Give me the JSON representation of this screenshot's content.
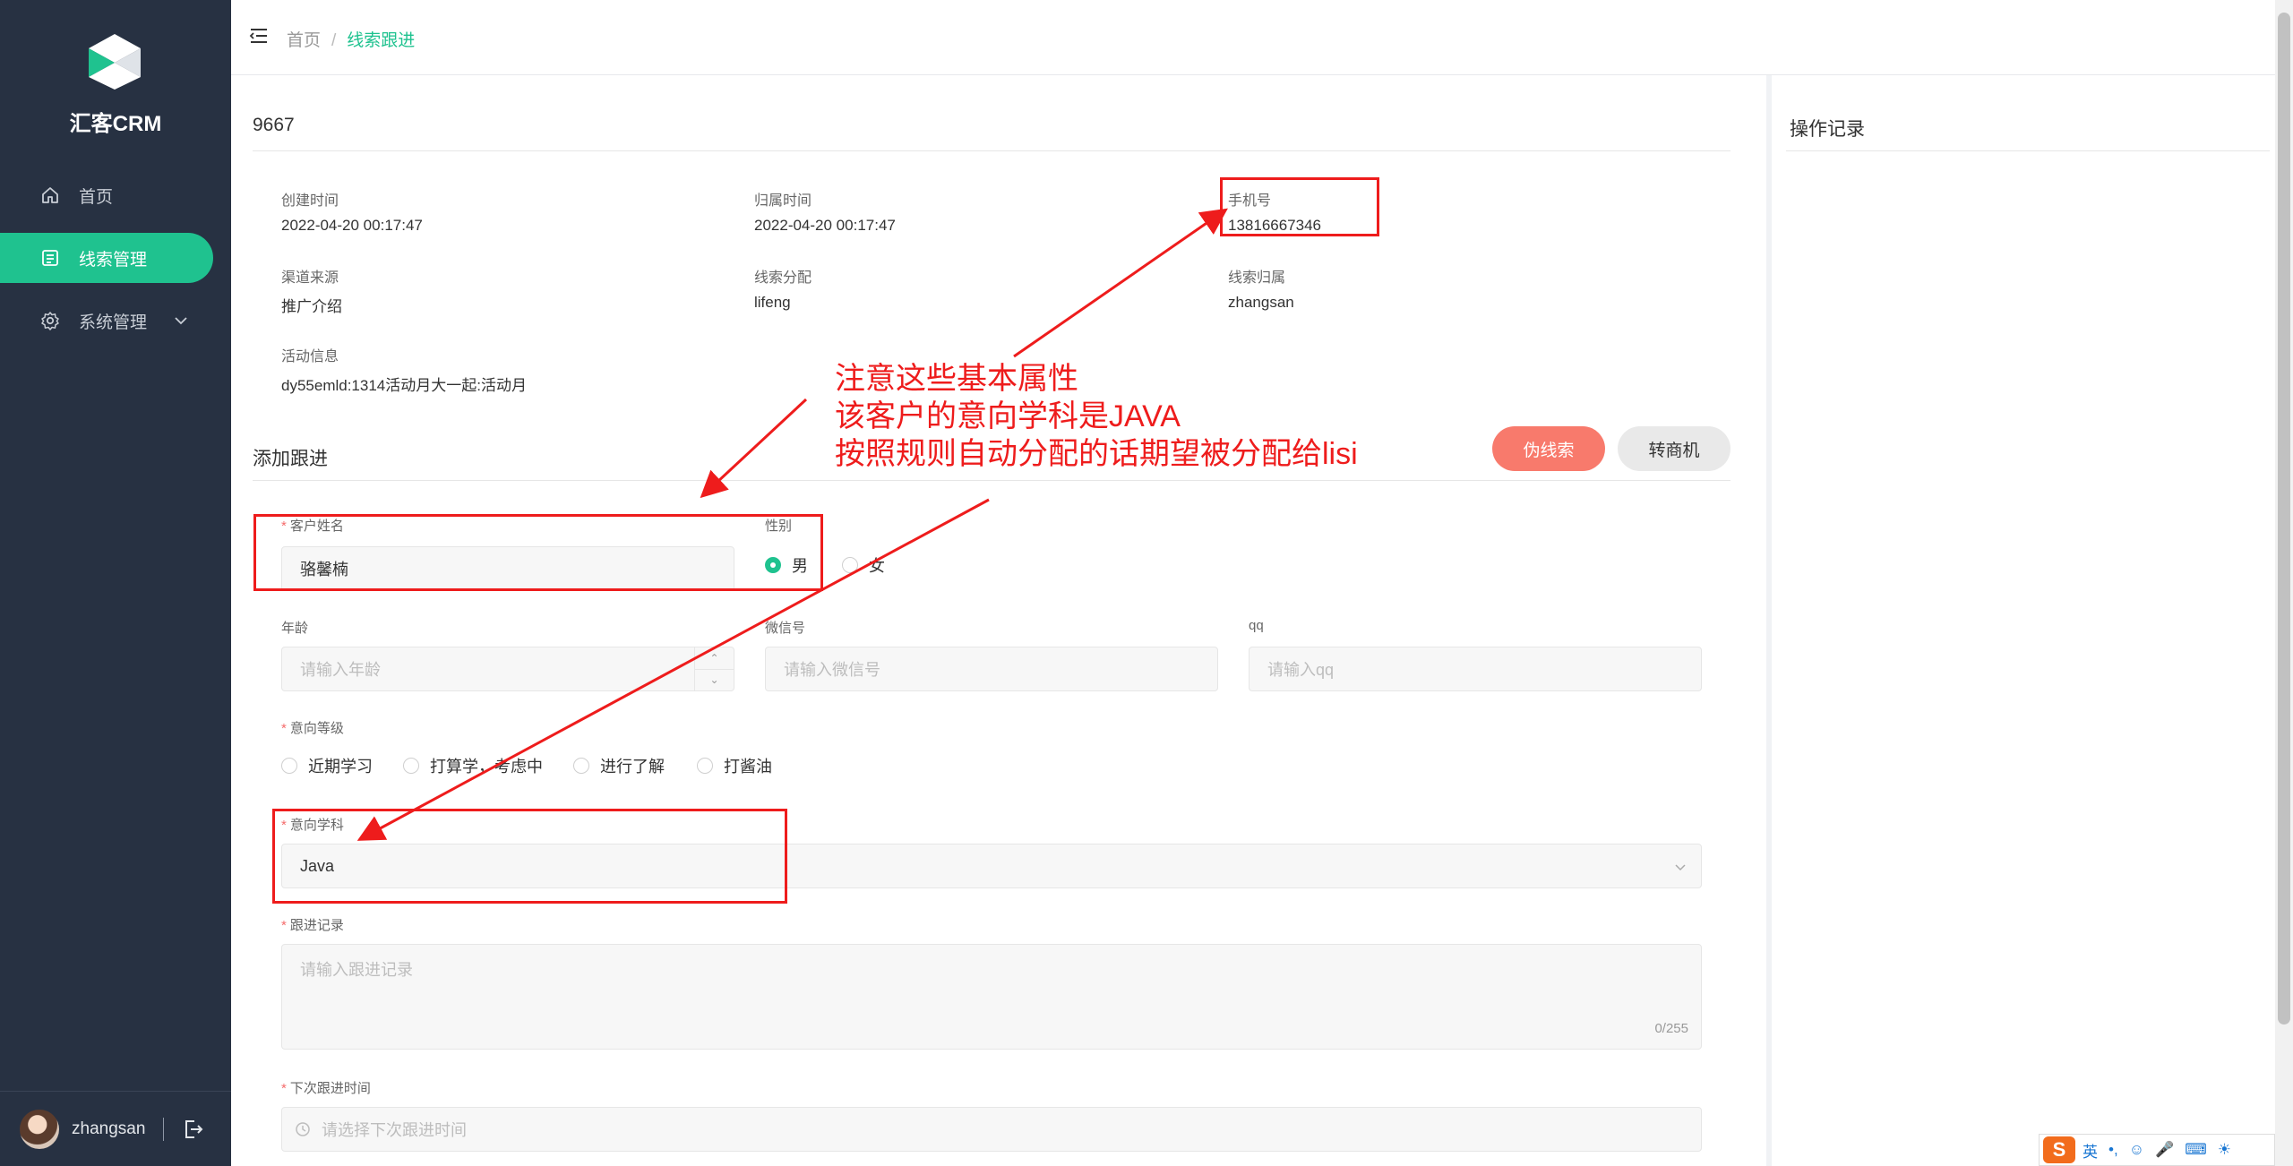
{
  "app": {
    "brand": "汇客CRM",
    "brand_colors": {
      "primary": "#1fc28f",
      "sidebar": "#273142",
      "danger": "#f87a6c",
      "annotation": "#ee1c1c"
    }
  },
  "sidebar": {
    "items": [
      {
        "label": "首页",
        "icon": "home-icon"
      },
      {
        "label": "线索管理",
        "icon": "document-list-icon",
        "active": true
      },
      {
        "label": "系统管理",
        "icon": "gear-icon",
        "has_submenu": true
      }
    ],
    "user": {
      "name": "zhangsan"
    }
  },
  "breadcrumb": {
    "home": "首页",
    "separator": "/",
    "current": "线索跟进"
  },
  "detail": {
    "title": "9667",
    "fields": {
      "created_label": "创建时间",
      "created_value": "2022-04-20 00:17:47",
      "assigned_time_label": "归属时间",
      "assigned_time_value": "2022-04-20 00:17:47",
      "phone_label": "手机号",
      "phone_value": "13816667346",
      "channel_label": "渠道来源",
      "channel_value": "推广介绍",
      "dispatch_label": "线索分配",
      "dispatch_value": "lifeng",
      "owner_label": "线索归属",
      "owner_value": "zhangsan",
      "activity_label": "活动信息",
      "activity_value": "dy55emld:1314活动月大一起:活动月"
    }
  },
  "followup": {
    "title": "添加跟进",
    "false_lead_button": "伪线索",
    "convert_button": "转商机",
    "customer_name_label": "客户姓名",
    "customer_name_value": "骆馨楠",
    "gender_label": "性别",
    "gender_options": [
      "男",
      "女"
    ],
    "gender_selected": "男",
    "age_label": "年龄",
    "age_placeholder": "请输入年龄",
    "wechat_label": "微信号",
    "wechat_placeholder": "请输入微信号",
    "qq_label": "qq",
    "qq_placeholder": "请输入qq",
    "intent_level_label": "意向等级",
    "intent_levels": [
      "近期学习",
      "打算学，考虑中",
      "进行了解",
      "打酱油"
    ],
    "subject_label": "意向学科",
    "subject_value": "Java",
    "record_label": "跟进记录",
    "record_placeholder": "请输入跟进记录",
    "record_counter": "0/255",
    "next_time_label": "下次跟进时间",
    "next_time_placeholder": "请选择下次跟进时间"
  },
  "right_panel": {
    "title": "操作记录"
  },
  "annotation": {
    "line1": "注意这些基本属性",
    "line2": "该客户的意向学科是JAVA",
    "line3": "按照规则自动分配的话期望被分配给lisi"
  },
  "ime": {
    "logo": "S",
    "lang": "英"
  }
}
